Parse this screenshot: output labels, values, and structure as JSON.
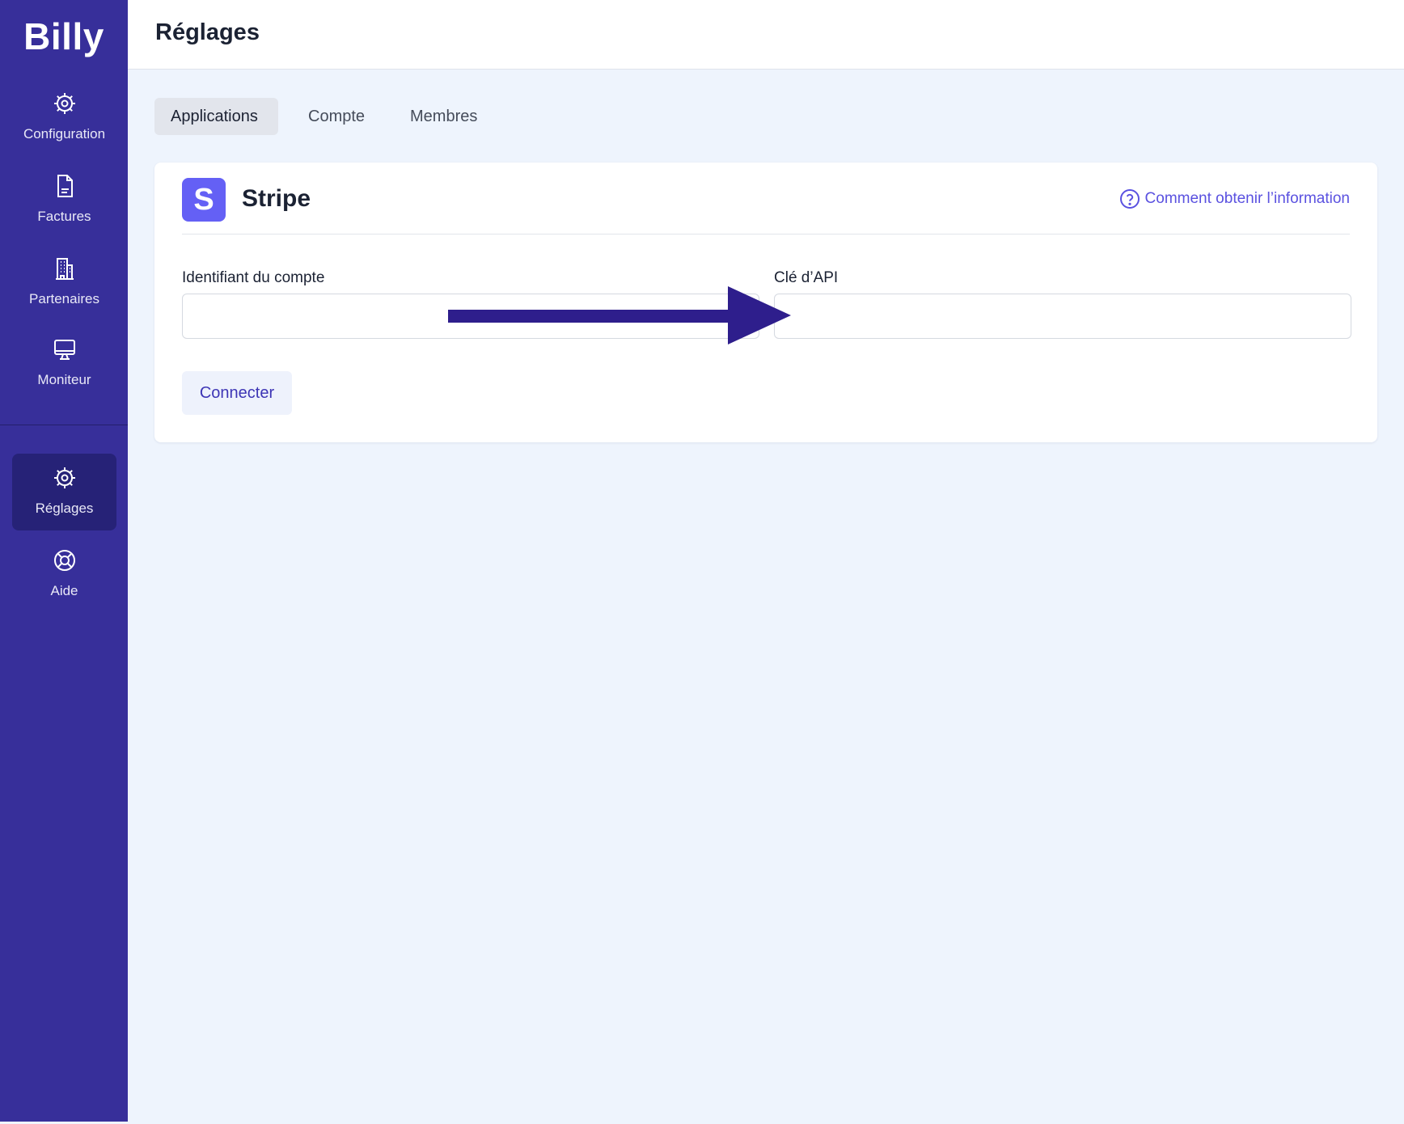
{
  "app": {
    "logo": "Billy"
  },
  "sidebar": {
    "items": [
      {
        "label": "Configuration",
        "icon": "gear-icon"
      },
      {
        "label": "Factures",
        "icon": "document-icon"
      },
      {
        "label": "Partenaires",
        "icon": "building-icon"
      },
      {
        "label": "Moniteur",
        "icon": "monitor-icon"
      }
    ],
    "bottom_items": [
      {
        "label": "Réglages",
        "icon": "gear-icon",
        "active": true
      },
      {
        "label": "Aide",
        "icon": "lifebuoy-icon"
      }
    ]
  },
  "header": {
    "title": "Réglages"
  },
  "tabs": [
    {
      "label": "Applications",
      "active": true
    },
    {
      "label": "Compte"
    },
    {
      "label": "Membres"
    }
  ],
  "integration": {
    "logo_letter": "S",
    "name": "Stripe",
    "help_link": "Comment obtenir l’information",
    "fields": [
      {
        "label": "Identifiant du compte",
        "value": "",
        "placeholder": ""
      },
      {
        "label": "Clé d’API",
        "value": "",
        "placeholder": ""
      }
    ],
    "connect_label": "Connecter"
  },
  "colors": {
    "sidebar": "#372f9a",
    "sidebar_active": "#262277",
    "accent": "#5a51e0",
    "stripe_brand": "#6460f5",
    "arrow": "#2e1e8c",
    "background": "#eef4fd"
  }
}
